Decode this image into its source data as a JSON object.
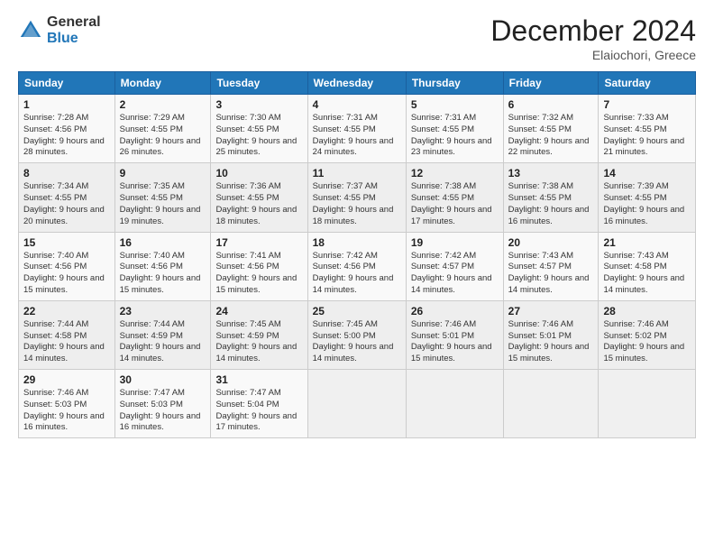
{
  "header": {
    "title": "December 2024",
    "subtitle": "Elaiochori, Greece"
  },
  "calendar": {
    "days": [
      "Sunday",
      "Monday",
      "Tuesday",
      "Wednesday",
      "Thursday",
      "Friday",
      "Saturday"
    ],
    "weeks": [
      [
        {
          "num": "1",
          "rise": "Sunrise: 7:28 AM",
          "set": "Sunset: 4:56 PM",
          "day": "Daylight: 9 hours and 28 minutes."
        },
        {
          "num": "2",
          "rise": "Sunrise: 7:29 AM",
          "set": "Sunset: 4:55 PM",
          "day": "Daylight: 9 hours and 26 minutes."
        },
        {
          "num": "3",
          "rise": "Sunrise: 7:30 AM",
          "set": "Sunset: 4:55 PM",
          "day": "Daylight: 9 hours and 25 minutes."
        },
        {
          "num": "4",
          "rise": "Sunrise: 7:31 AM",
          "set": "Sunset: 4:55 PM",
          "day": "Daylight: 9 hours and 24 minutes."
        },
        {
          "num": "5",
          "rise": "Sunrise: 7:31 AM",
          "set": "Sunset: 4:55 PM",
          "day": "Daylight: 9 hours and 23 minutes."
        },
        {
          "num": "6",
          "rise": "Sunrise: 7:32 AM",
          "set": "Sunset: 4:55 PM",
          "day": "Daylight: 9 hours and 22 minutes."
        },
        {
          "num": "7",
          "rise": "Sunrise: 7:33 AM",
          "set": "Sunset: 4:55 PM",
          "day": "Daylight: 9 hours and 21 minutes."
        }
      ],
      [
        {
          "num": "8",
          "rise": "Sunrise: 7:34 AM",
          "set": "Sunset: 4:55 PM",
          "day": "Daylight: 9 hours and 20 minutes."
        },
        {
          "num": "9",
          "rise": "Sunrise: 7:35 AM",
          "set": "Sunset: 4:55 PM",
          "day": "Daylight: 9 hours and 19 minutes."
        },
        {
          "num": "10",
          "rise": "Sunrise: 7:36 AM",
          "set": "Sunset: 4:55 PM",
          "day": "Daylight: 9 hours and 18 minutes."
        },
        {
          "num": "11",
          "rise": "Sunrise: 7:37 AM",
          "set": "Sunset: 4:55 PM",
          "day": "Daylight: 9 hours and 18 minutes."
        },
        {
          "num": "12",
          "rise": "Sunrise: 7:38 AM",
          "set": "Sunset: 4:55 PM",
          "day": "Daylight: 9 hours and 17 minutes."
        },
        {
          "num": "13",
          "rise": "Sunrise: 7:38 AM",
          "set": "Sunset: 4:55 PM",
          "day": "Daylight: 9 hours and 16 minutes."
        },
        {
          "num": "14",
          "rise": "Sunrise: 7:39 AM",
          "set": "Sunset: 4:55 PM",
          "day": "Daylight: 9 hours and 16 minutes."
        }
      ],
      [
        {
          "num": "15",
          "rise": "Sunrise: 7:40 AM",
          "set": "Sunset: 4:56 PM",
          "day": "Daylight: 9 hours and 15 minutes."
        },
        {
          "num": "16",
          "rise": "Sunrise: 7:40 AM",
          "set": "Sunset: 4:56 PM",
          "day": "Daylight: 9 hours and 15 minutes."
        },
        {
          "num": "17",
          "rise": "Sunrise: 7:41 AM",
          "set": "Sunset: 4:56 PM",
          "day": "Daylight: 9 hours and 15 minutes."
        },
        {
          "num": "18",
          "rise": "Sunrise: 7:42 AM",
          "set": "Sunset: 4:56 PM",
          "day": "Daylight: 9 hours and 14 minutes."
        },
        {
          "num": "19",
          "rise": "Sunrise: 7:42 AM",
          "set": "Sunset: 4:57 PM",
          "day": "Daylight: 9 hours and 14 minutes."
        },
        {
          "num": "20",
          "rise": "Sunrise: 7:43 AM",
          "set": "Sunset: 4:57 PM",
          "day": "Daylight: 9 hours and 14 minutes."
        },
        {
          "num": "21",
          "rise": "Sunrise: 7:43 AM",
          "set": "Sunset: 4:58 PM",
          "day": "Daylight: 9 hours and 14 minutes."
        }
      ],
      [
        {
          "num": "22",
          "rise": "Sunrise: 7:44 AM",
          "set": "Sunset: 4:58 PM",
          "day": "Daylight: 9 hours and 14 minutes."
        },
        {
          "num": "23",
          "rise": "Sunrise: 7:44 AM",
          "set": "Sunset: 4:59 PM",
          "day": "Daylight: 9 hours and 14 minutes."
        },
        {
          "num": "24",
          "rise": "Sunrise: 7:45 AM",
          "set": "Sunset: 4:59 PM",
          "day": "Daylight: 9 hours and 14 minutes."
        },
        {
          "num": "25",
          "rise": "Sunrise: 7:45 AM",
          "set": "Sunset: 5:00 PM",
          "day": "Daylight: 9 hours and 14 minutes."
        },
        {
          "num": "26",
          "rise": "Sunrise: 7:46 AM",
          "set": "Sunset: 5:01 PM",
          "day": "Daylight: 9 hours and 15 minutes."
        },
        {
          "num": "27",
          "rise": "Sunrise: 7:46 AM",
          "set": "Sunset: 5:01 PM",
          "day": "Daylight: 9 hours and 15 minutes."
        },
        {
          "num": "28",
          "rise": "Sunrise: 7:46 AM",
          "set": "Sunset: 5:02 PM",
          "day": "Daylight: 9 hours and 15 minutes."
        }
      ],
      [
        {
          "num": "29",
          "rise": "Sunrise: 7:46 AM",
          "set": "Sunset: 5:03 PM",
          "day": "Daylight: 9 hours and 16 minutes."
        },
        {
          "num": "30",
          "rise": "Sunrise: 7:47 AM",
          "set": "Sunset: 5:03 PM",
          "day": "Daylight: 9 hours and 16 minutes."
        },
        {
          "num": "31",
          "rise": "Sunrise: 7:47 AM",
          "set": "Sunset: 5:04 PM",
          "day": "Daylight: 9 hours and 17 minutes."
        },
        null,
        null,
        null,
        null
      ]
    ]
  }
}
